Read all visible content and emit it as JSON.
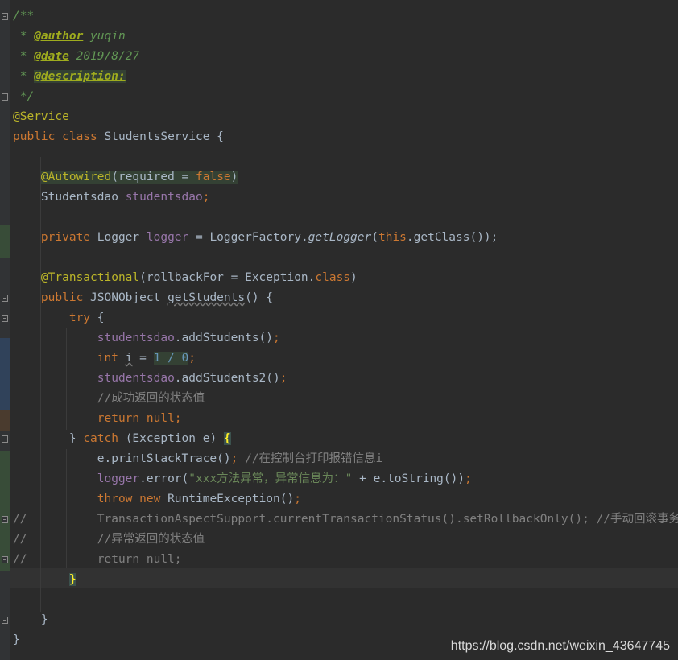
{
  "colors": {
    "background": "#2b2b2b",
    "gutter": "#313335",
    "keyword": "#cc7832",
    "annotation": "#bbb529",
    "field": "#9876aa",
    "number": "#6897bb",
    "string": "#6a8759",
    "comment": "#808080",
    "doc": "#629755",
    "doc_tag": "#9fac1e",
    "text": "#a9b7c6",
    "bracket_match": "#ffef28"
  },
  "code_lines": [
    [
      {
        "t": "/**",
        "c": "doc"
      }
    ],
    [
      {
        "t": " * ",
        "c": "doc"
      },
      {
        "t": "@author",
        "c": "doctag"
      },
      {
        "t": " yuqin",
        "c": "doc"
      }
    ],
    [
      {
        "t": " * ",
        "c": "doc"
      },
      {
        "t": "@date",
        "c": "doctag"
      },
      {
        "t": " 2019/8/27",
        "c": "doc"
      }
    ],
    [
      {
        "t": " * ",
        "c": "doc"
      },
      {
        "t": "@description:",
        "c": "doctag",
        "hl": true
      }
    ],
    [
      {
        "t": " */",
        "c": "doc"
      }
    ],
    [
      {
        "t": "@Service",
        "c": "annotation"
      }
    ],
    [
      {
        "t": "public class ",
        "c": "kw"
      },
      {
        "t": "StudentsService {",
        "c": "plain"
      }
    ],
    [],
    [
      {
        "t": "    ",
        "c": "plain"
      },
      {
        "t": "@Autowired",
        "c": "annotation",
        "hl": true
      },
      {
        "t": "(required = ",
        "c": "plain",
        "hl": true
      },
      {
        "t": "false",
        "c": "kw",
        "hl": true
      },
      {
        "t": ")",
        "c": "plain",
        "hl": true
      }
    ],
    [
      {
        "t": "    Studentsdao ",
        "c": "plain"
      },
      {
        "t": "studentsdao",
        "c": "field"
      },
      {
        "t": ";",
        "c": "kw"
      }
    ],
    [],
    [
      {
        "t": "    ",
        "c": "plain"
      },
      {
        "t": "private ",
        "c": "kw"
      },
      {
        "t": "Logger ",
        "c": "plain"
      },
      {
        "t": "logger",
        "c": "field"
      },
      {
        "t": " = LoggerFactory.",
        "c": "plain"
      },
      {
        "t": "getLogger",
        "c": "italic"
      },
      {
        "t": "(",
        "c": "plain"
      },
      {
        "t": "this",
        "c": "kw"
      },
      {
        "t": ".getClass());",
        "c": "plain"
      }
    ],
    [],
    [
      {
        "t": "    ",
        "c": "plain"
      },
      {
        "t": "@Transactional",
        "c": "annotation"
      },
      {
        "t": "(rollbackFor = Exception.",
        "c": "plain"
      },
      {
        "t": "class",
        "c": "kw"
      },
      {
        "t": ")",
        "c": "plain"
      }
    ],
    [
      {
        "t": "    ",
        "c": "plain"
      },
      {
        "t": "public ",
        "c": "kw"
      },
      {
        "t": "JSONObject ",
        "c": "plain"
      },
      {
        "t": "getStudents",
        "c": "method-underline"
      },
      {
        "t": "() {",
        "c": "plain"
      }
    ],
    [
      {
        "t": "        ",
        "c": "plain"
      },
      {
        "t": "try ",
        "c": "kw"
      },
      {
        "t": "{",
        "c": "plain"
      }
    ],
    [
      {
        "t": "            ",
        "c": "plain"
      },
      {
        "t": "studentsdao",
        "c": "field"
      },
      {
        "t": ".addStudents()",
        "c": "plain"
      },
      {
        "t": ";",
        "c": "kw"
      }
    ],
    [
      {
        "t": "            ",
        "c": "plain"
      },
      {
        "t": "int ",
        "c": "kw"
      },
      {
        "t": "i",
        "c": "plain-underline"
      },
      {
        "t": " = ",
        "c": "plain"
      },
      {
        "t": "1 / 0",
        "c": "number",
        "hl": true
      },
      {
        "t": ";",
        "c": "kw"
      }
    ],
    [
      {
        "t": "            ",
        "c": "plain"
      },
      {
        "t": "studentsdao",
        "c": "field"
      },
      {
        "t": ".addStudents2()",
        "c": "plain"
      },
      {
        "t": ";",
        "c": "kw"
      }
    ],
    [
      {
        "t": "            ",
        "c": "plain"
      },
      {
        "t": "//成功返回的状态值",
        "c": "comment"
      }
    ],
    [
      {
        "t": "            ",
        "c": "plain"
      },
      {
        "t": "return null",
        "c": "kw"
      },
      {
        "t": ";",
        "c": "kw"
      }
    ],
    [
      {
        "t": "        } ",
        "c": "plain"
      },
      {
        "t": "catch ",
        "c": "kw"
      },
      {
        "t": "(Exception e) ",
        "c": "plain"
      },
      {
        "t": "{",
        "c": "match"
      }
    ],
    [
      {
        "t": "            e.printStackTrace()",
        "c": "plain"
      },
      {
        "t": "; ",
        "c": "kw"
      },
      {
        "t": "//在控制台打印报错信息i",
        "c": "comment"
      }
    ],
    [
      {
        "t": "            ",
        "c": "plain"
      },
      {
        "t": "logger",
        "c": "field"
      },
      {
        "t": ".error(",
        "c": "plain"
      },
      {
        "t": "\"xxx方法异常，异常信息为：\"",
        "c": "string"
      },
      {
        "t": " + e.toString())",
        "c": "plain"
      },
      {
        "t": ";",
        "c": "kw"
      }
    ],
    [
      {
        "t": "            ",
        "c": "plain"
      },
      {
        "t": "throw new ",
        "c": "kw"
      },
      {
        "t": "RuntimeException()",
        "c": "plain"
      },
      {
        "t": ";",
        "c": "kw"
      }
    ],
    [
      {
        "t": "//          TransactionAspectSupport.currentTransactionStatus().setRollbackOnly(); //手动回滚事务",
        "c": "comment"
      }
    ],
    [
      {
        "t": "//          //异常返回的状态值",
        "c": "comment"
      }
    ],
    [
      {
        "t": "//          return null;",
        "c": "comment"
      }
    ],
    [
      {
        "t": "        ",
        "c": "plain"
      },
      {
        "t": "}",
        "c": "match"
      }
    ],
    [],
    [
      {
        "t": "    }",
        "c": "plain"
      }
    ],
    [
      {
        "t": "}",
        "c": "plain"
      }
    ]
  ],
  "watermark": "https://blog.csdn.net/weixin_43647745"
}
